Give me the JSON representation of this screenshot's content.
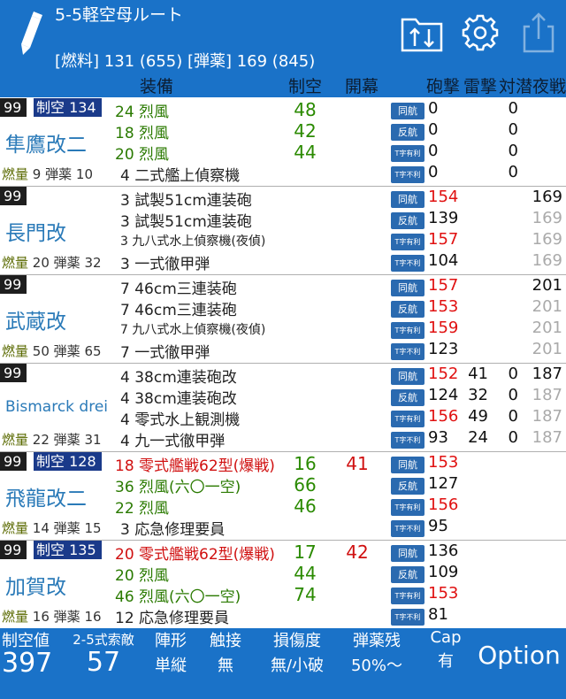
{
  "header": {
    "title": "5-5軽空母ルート",
    "resources": "[燃料] 131 (655) [弾薬] 169 (845)"
  },
  "columns": {
    "equip": "装備",
    "aa": "制空",
    "opening": "開幕",
    "shell": "砲撃",
    "torp": "雷撃",
    "asw": "対潜",
    "night": "夜戦"
  },
  "ships": [
    {
      "level": "99",
      "aa_badge": "制空 134",
      "name": "隼鷹改二",
      "fuel_label": "燃量",
      "fuel": "9",
      "ammo_label": "弾薬",
      "ammo": "10",
      "equips": [
        {
          "text": "24 烈風",
          "color": "green",
          "aa": "48",
          "aa_color": "green",
          "opening": ""
        },
        {
          "text": "18 烈風",
          "color": "green",
          "aa": "42",
          "aa_color": "green",
          "opening": ""
        },
        {
          "text": "20 烈風",
          "color": "green",
          "aa": "44",
          "aa_color": "green",
          "opening": ""
        },
        {
          "text": "4 二式艦上偵察機",
          "color": "",
          "aa": "",
          "opening": ""
        }
      ],
      "rows": [
        {
          "badge": "同航",
          "shell": "0",
          "shell_c": "dark",
          "torp": "",
          "asw": "0",
          "night": "",
          "night_c": "dark"
        },
        {
          "badge": "反航",
          "shell": "0",
          "shell_c": "dark",
          "torp": "",
          "asw": "0",
          "night": "",
          "night_c": "dark"
        },
        {
          "badge": "T字有利",
          "shell": "0",
          "shell_c": "dark",
          "torp": "",
          "asw": "0",
          "night": "",
          "night_c": "dark"
        },
        {
          "badge": "T字不利",
          "shell": "0",
          "shell_c": "dark",
          "torp": "",
          "asw": "0",
          "night": "",
          "night_c": "dark"
        }
      ]
    },
    {
      "level": "99",
      "aa_badge": "",
      "name": "長門改",
      "fuel_label": "燃量",
      "fuel": "20",
      "ammo_label": "弾薬",
      "ammo": "32",
      "equips": [
        {
          "text": "3 試製51cm連装砲",
          "color": "",
          "aa": "",
          "opening": ""
        },
        {
          "text": "3 試製51cm連装砲",
          "color": "",
          "aa": "",
          "opening": ""
        },
        {
          "text": "3 九八式水上偵察機(夜偵)",
          "color": "",
          "small": true,
          "aa": "",
          "opening": ""
        },
        {
          "text": "3 一式徹甲弾",
          "color": "",
          "aa": "",
          "opening": ""
        }
      ],
      "rows": [
        {
          "badge": "同航",
          "shell": "154",
          "shell_c": "red",
          "torp": "",
          "asw": "",
          "night": "169",
          "night_c": "dark"
        },
        {
          "badge": "反航",
          "shell": "139",
          "shell_c": "dark",
          "torp": "",
          "asw": "",
          "night": "169",
          "night_c": "grey"
        },
        {
          "badge": "T字有利",
          "shell": "157",
          "shell_c": "red",
          "torp": "",
          "asw": "",
          "night": "169",
          "night_c": "grey"
        },
        {
          "badge": "T字不利",
          "shell": "104",
          "shell_c": "dark",
          "torp": "",
          "asw": "",
          "night": "169",
          "night_c": "grey"
        }
      ]
    },
    {
      "level": "99",
      "aa_badge": "",
      "name": "武蔵改",
      "fuel_label": "燃量",
      "fuel": "50",
      "ammo_label": "弾薬",
      "ammo": "65",
      "equips": [
        {
          "text": "7 46cm三連装砲",
          "color": "",
          "aa": "",
          "opening": ""
        },
        {
          "text": "7 46cm三連装砲",
          "color": "",
          "aa": "",
          "opening": ""
        },
        {
          "text": "7 九八式水上偵察機(夜偵)",
          "color": "",
          "small": true,
          "aa": "",
          "opening": ""
        },
        {
          "text": "7 一式徹甲弾",
          "color": "",
          "aa": "",
          "opening": ""
        }
      ],
      "rows": [
        {
          "badge": "同航",
          "shell": "157",
          "shell_c": "red",
          "torp": "",
          "asw": "",
          "night": "201",
          "night_c": "dark"
        },
        {
          "badge": "反航",
          "shell": "153",
          "shell_c": "red",
          "torp": "",
          "asw": "",
          "night": "201",
          "night_c": "grey"
        },
        {
          "badge": "T字有利",
          "shell": "159",
          "shell_c": "red",
          "torp": "",
          "asw": "",
          "night": "201",
          "night_c": "grey"
        },
        {
          "badge": "T字不利",
          "shell": "123",
          "shell_c": "dark",
          "torp": "",
          "asw": "",
          "night": "201",
          "night_c": "grey"
        }
      ]
    },
    {
      "level": "99",
      "aa_badge": "",
      "name": "Bismarck drei",
      "name_small": true,
      "fuel_label": "燃量",
      "fuel": "22",
      "ammo_label": "弾薬",
      "ammo": "31",
      "equips": [
        {
          "text": "4 38cm連装砲改",
          "color": "",
          "aa": "",
          "opening": ""
        },
        {
          "text": "4 38cm連装砲改",
          "color": "",
          "aa": "",
          "opening": ""
        },
        {
          "text": "4 零式水上観測機",
          "color": "",
          "aa": "",
          "opening": ""
        },
        {
          "text": "4 九一式徹甲弾",
          "color": "",
          "aa": "",
          "opening": ""
        }
      ],
      "rows": [
        {
          "badge": "同航",
          "shell": "152",
          "shell_c": "red",
          "torp": "41",
          "asw": "0",
          "night": "187",
          "night_c": "dark"
        },
        {
          "badge": "反航",
          "shell": "124",
          "shell_c": "dark",
          "torp": "32",
          "asw": "0",
          "night": "187",
          "night_c": "grey"
        },
        {
          "badge": "T字有利",
          "shell": "156",
          "shell_c": "red",
          "torp": "49",
          "asw": "0",
          "night": "187",
          "night_c": "grey"
        },
        {
          "badge": "T字不利",
          "shell": "93",
          "shell_c": "dark",
          "torp": "24",
          "asw": "0",
          "night": "187",
          "night_c": "grey"
        }
      ]
    },
    {
      "level": "99",
      "aa_badge": "制空 128",
      "name": "飛龍改二",
      "fuel_label": "燃量",
      "fuel": "14",
      "ammo_label": "弾薬",
      "ammo": "15",
      "equips": [
        {
          "text": "18 零式艦戦62型(爆戦)",
          "color": "red",
          "aa": "16",
          "aa_color": "green",
          "opening": "41"
        },
        {
          "text": "36 烈風(六〇一空)",
          "color": "green",
          "aa": "66",
          "aa_color": "green",
          "opening": ""
        },
        {
          "text": "22 烈風",
          "color": "green",
          "aa": "46",
          "aa_color": "green",
          "opening": ""
        },
        {
          "text": "3 応急修理要員",
          "color": "",
          "aa": "",
          "opening": ""
        }
      ],
      "rows": [
        {
          "badge": "同航",
          "shell": "153",
          "shell_c": "red",
          "torp": "",
          "asw": "",
          "night": "",
          "night_c": "dark"
        },
        {
          "badge": "反航",
          "shell": "127",
          "shell_c": "dark",
          "torp": "",
          "asw": "",
          "night": "",
          "night_c": "dark"
        },
        {
          "badge": "T字有利",
          "shell": "156",
          "shell_c": "red",
          "torp": "",
          "asw": "",
          "night": "",
          "night_c": "dark"
        },
        {
          "badge": "T字不利",
          "shell": "95",
          "shell_c": "dark",
          "torp": "",
          "asw": "",
          "night": "",
          "night_c": "dark"
        }
      ]
    },
    {
      "level": "99",
      "aa_badge": "制空 135",
      "name": "加賀改",
      "fuel_label": "燃量",
      "fuel": "16",
      "ammo_label": "弾薬",
      "ammo": "16",
      "equips": [
        {
          "text": "20 零式艦戦62型(爆戦)",
          "color": "red",
          "aa": "17",
          "aa_color": "green",
          "opening": "42"
        },
        {
          "text": "20 烈風",
          "color": "green",
          "aa": "44",
          "aa_color": "green",
          "opening": ""
        },
        {
          "text": "46 烈風(六〇一空)",
          "color": "green",
          "aa": "74",
          "aa_color": "green",
          "opening": ""
        },
        {
          "text": "12 応急修理要員",
          "color": "",
          "aa": "",
          "opening": ""
        }
      ],
      "rows": [
        {
          "badge": "同航",
          "shell": "136",
          "shell_c": "dark",
          "torp": "",
          "asw": "",
          "night": "",
          "night_c": "dark"
        },
        {
          "badge": "反航",
          "shell": "109",
          "shell_c": "dark",
          "torp": "",
          "asw": "",
          "night": "",
          "night_c": "dark"
        },
        {
          "badge": "T字有利",
          "shell": "153",
          "shell_c": "red",
          "torp": "",
          "asw": "",
          "night": "",
          "night_c": "dark"
        },
        {
          "badge": "T字不利",
          "shell": "81",
          "shell_c": "dark",
          "torp": "",
          "asw": "",
          "night": "",
          "night_c": "dark"
        }
      ]
    }
  ],
  "footer": {
    "air_label": "制空値",
    "air_value": "397",
    "search_label": "2-5式索敵",
    "search_value": "57",
    "formation_label": "陣形",
    "formation_value": "単縦",
    "contact_label": "触接",
    "contact_value": "無",
    "damage_label": "損傷度",
    "damage_value": "無/小破",
    "ammo_label": "弾薬残",
    "ammo_value": "50%〜",
    "cap_label": "Cap",
    "cap_value": "有",
    "option_label": "Option"
  }
}
